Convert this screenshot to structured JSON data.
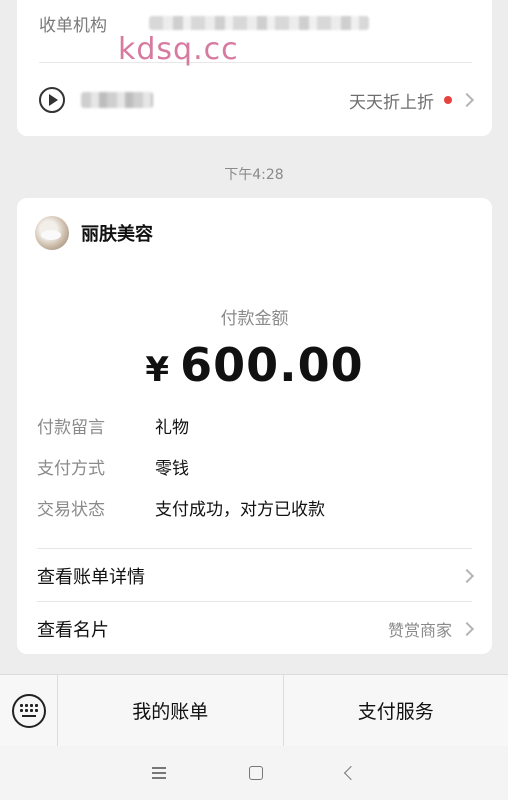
{
  "top_card": {
    "merchant_label": "收单机构",
    "promo_text": "天天折上折"
  },
  "watermark": "kdsq.cc",
  "time_label": "下午4:28",
  "payment": {
    "shop_name": "丽肤美容",
    "amount_label": "付款金额",
    "currency_symbol": "¥",
    "amount": "600.00",
    "details": [
      {
        "key": "付款留言",
        "value": "礼物"
      },
      {
        "key": "支付方式",
        "value": "零钱"
      },
      {
        "key": "交易状态",
        "value": "支付成功，对方已收款"
      }
    ],
    "bill_details_link": "查看账单详情",
    "card_link": "查看名片",
    "card_link_sub": "赞赏商家"
  },
  "menu": {
    "my_bills": "我的账单",
    "payment_services": "支付服务"
  },
  "colors": {
    "background": "#ededed",
    "card": "#ffffff",
    "red_dot": "#e64340",
    "watermark": "#d77aa0"
  }
}
